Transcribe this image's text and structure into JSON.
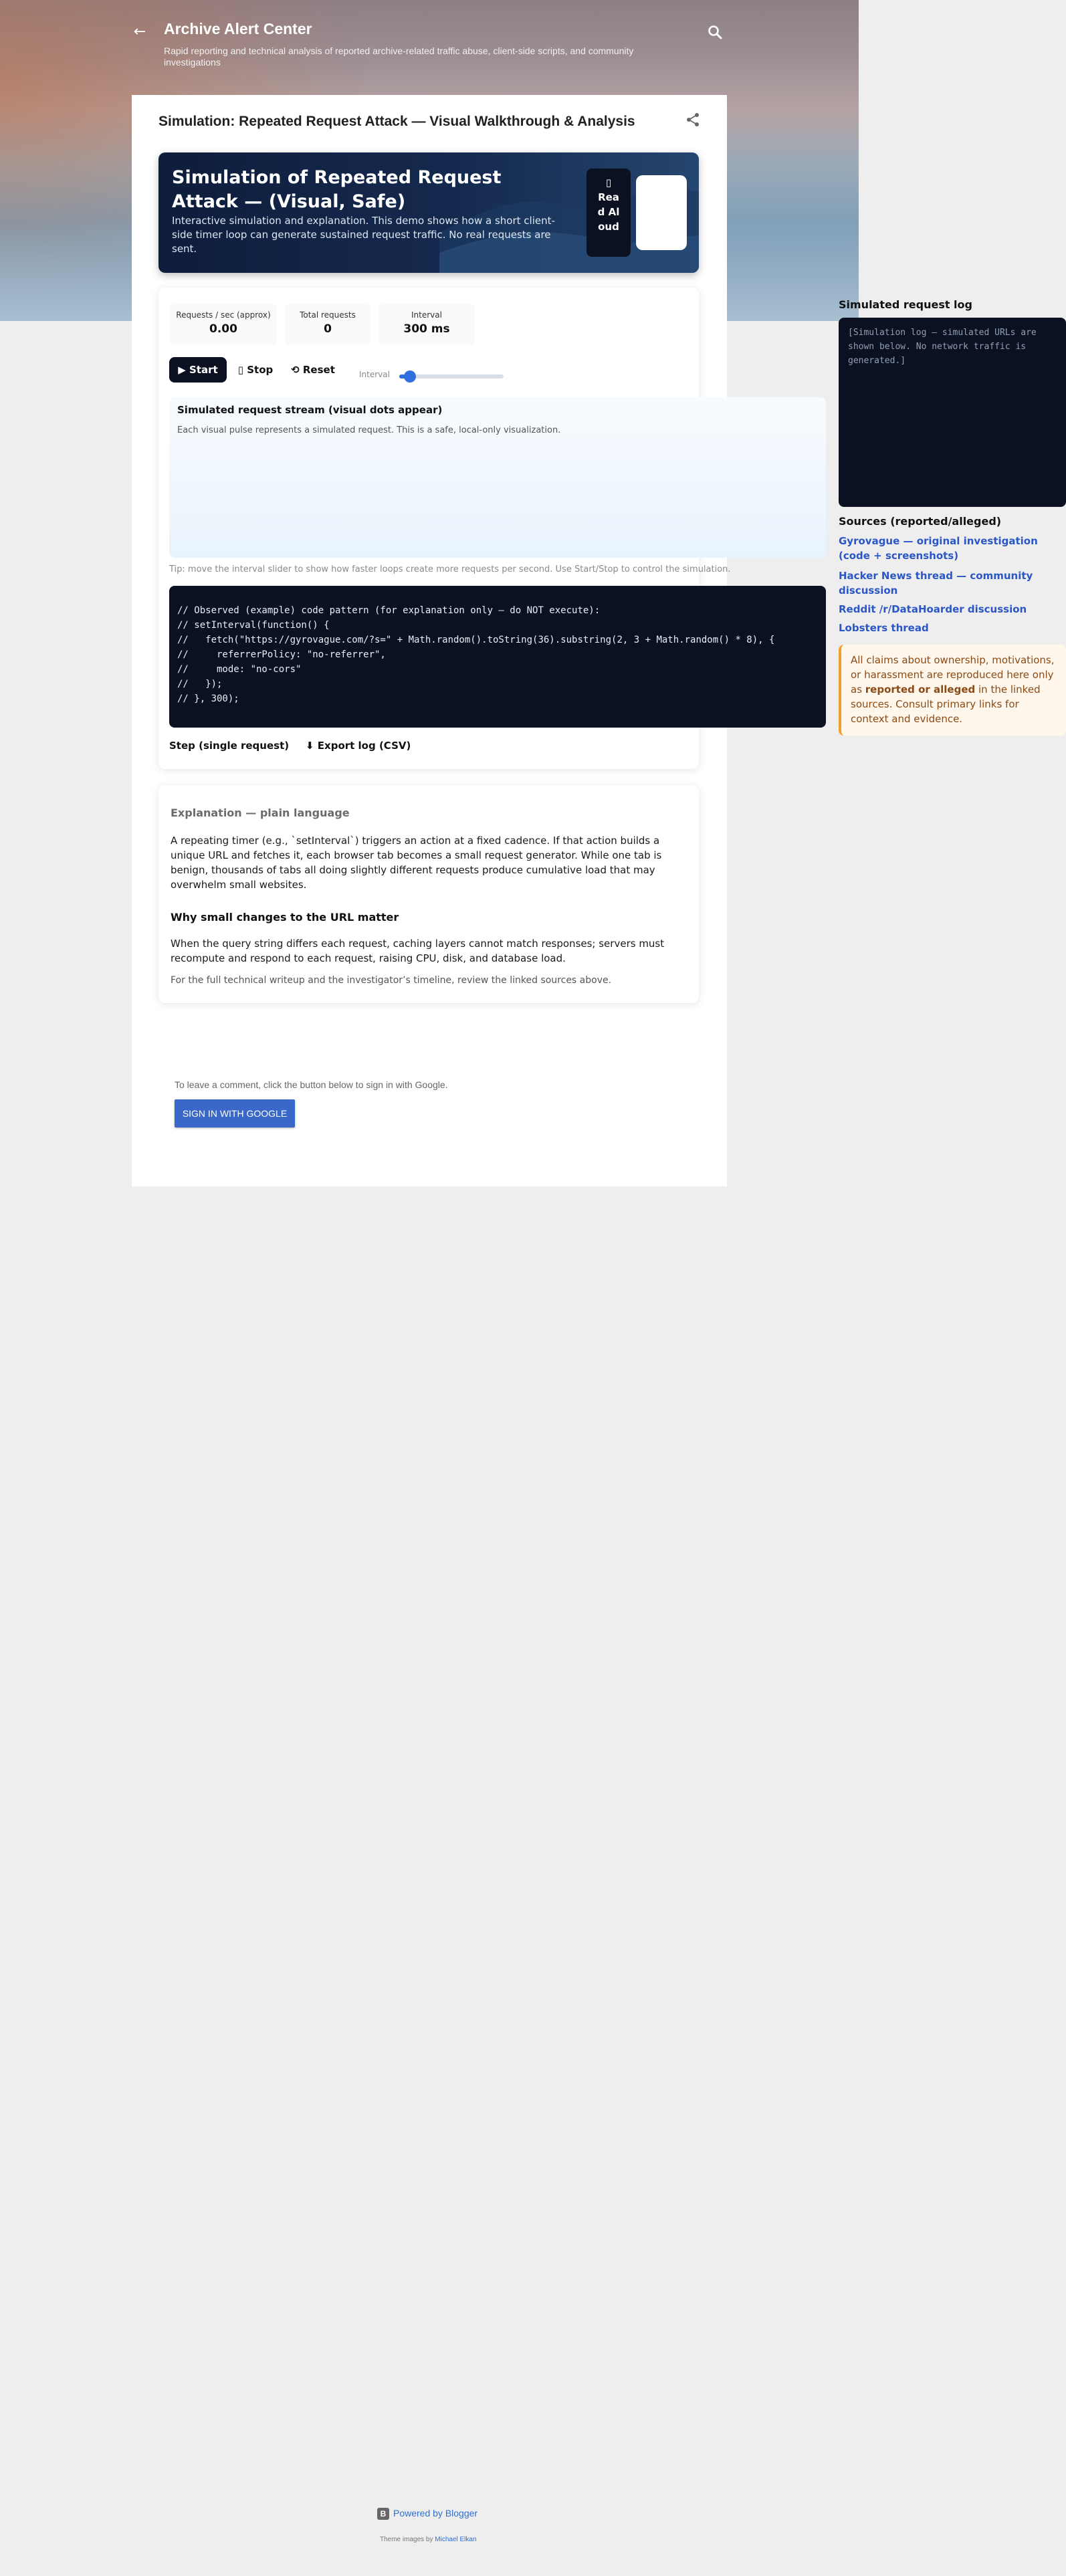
{
  "header": {
    "back_icon": "arrow-left-icon",
    "title": "Archive Alert Center",
    "description": "Rapid reporting and technical analysis of reported archive-related traffic abuse, client-side scripts, and community investigations",
    "search_icon": "search-icon"
  },
  "post": {
    "title": "Simulation: Repeated Request Attack — Visual Walkthrough & Analysis",
    "share_icon": "share-icon"
  },
  "banner": {
    "title": "Simulation of Repeated Request Attack — (Visual, Safe)",
    "description": "Interactive simulation and explanation. This demo shows how a short client-side timer loop can generate sustained request traffic. No real requests are sent.",
    "read_aloud_icon": "speaker-icon",
    "read_aloud_label": "Read Aloud"
  },
  "stats": {
    "rps_label": "Requests / sec (approx)",
    "rps_value": "0.00",
    "total_label": "Total requests",
    "total_value": "0",
    "interval_label": "Interval",
    "interval_value": "300 ms"
  },
  "controls": {
    "start_label": "▶ Start",
    "stop_label": "▯ Stop",
    "reset_label": "⟲ Reset",
    "interval_label": "Interval",
    "interval_slider_fraction": 0.1
  },
  "stream": {
    "title": "Simulated request stream (visual dots appear)",
    "description": "Each visual pulse represents a simulated request. This is a safe, local-only visualization."
  },
  "tip": "Tip: move the interval slider to show how faster loops create more requests per second. Use Start/Stop to control the simulation.",
  "code_lines": [
    "// Observed (example) code pattern (for explanation only — do NOT execute):",
    "// setInterval(function() {",
    "//   fetch(\"https://gyrovague.com/?s=\" + Math.random().toString(36).substring(2, 3 + Math.random() * 8), {",
    "//     referrerPolicy: \"no-referrer\",",
    "//     mode: \"no-cors\"",
    "//   });",
    "// }, 300);"
  ],
  "actions": {
    "step_label": "Step (single request)",
    "export_label": "⬇ Export log (CSV)"
  },
  "explanation": {
    "heading": "Explanation — plain language",
    "paragraph1": "A repeating timer (e.g., `setInterval`) triggers an action at a fixed cadence. If that action builds a unique URL and fetches it, each browser tab becomes a small request generator. While one tab is benign, thousands of tabs all doing slightly different requests produce cumulative load that may overwhelm small websites.",
    "heading2": "Why small changes to the URL matter",
    "paragraph2": "When the query string differs each request, caching layers cannot match responses; servers must recompute and respond to each request, raising CPU, disk, and database load.",
    "note": "For the full technical writeup and the investigator’s timeline, review the linked sources above."
  },
  "comments": {
    "note": "To leave a comment, click the button below to sign in with Google.",
    "signin_label": "SIGN IN WITH GOOGLE"
  },
  "sidebar": {
    "log_title": "Simulated request log",
    "log_text": "[Simulation log — simulated URLs are shown below. No network traffic is generated.]",
    "sources_title": "Sources (reported/alleged)",
    "sources": [
      "Gyrovague — original investigation (code + screenshots)",
      "Hacker News thread — community discussion",
      "Reddit /r/DataHoarder discussion",
      "Lobsters thread"
    ],
    "disclaimer_pre": "All claims about ownership, motivations, or harassment are reproduced here only as ",
    "disclaimer_strong": "reported or alleged",
    "disclaimer_post": " in the linked sources. Consult primary links for context and evidence."
  },
  "footer": {
    "blogger_icon": "blogger-icon",
    "powered_by": "Powered by Blogger",
    "theme_prefix": "Theme images by",
    "theme_author": "Michael Elkan"
  },
  "colors": {
    "accent": "#2f6fde",
    "dark": "#0b1120",
    "link": "#2a56c6",
    "signin": "#3a68c9"
  }
}
